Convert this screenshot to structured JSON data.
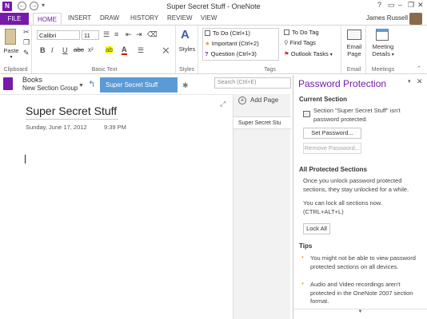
{
  "window": {
    "title": "Super Secret Stuff - OneNote",
    "help": "?",
    "minimize": "–",
    "restore": "❐",
    "close": "✕",
    "user": "James Russell"
  },
  "quick_access": {
    "back": "←",
    "forward": "→",
    "more": "▾"
  },
  "ribbon_tabs": [
    "FILE",
    "HOME",
    "INSERT",
    "DRAW",
    "HISTORY",
    "REVIEW",
    "VIEW"
  ],
  "clipboard": {
    "paste": "Paste",
    "label": "Clipboard"
  },
  "basic_text": {
    "font": "Calibri",
    "size": "11",
    "bold": "B",
    "italic": "I",
    "underline": "U",
    "strike": "abc",
    "subscript": "x²",
    "highlight": "ab",
    "fontcolor": "A",
    "label": "Basic Text"
  },
  "styles": {
    "label": "Styles",
    "button": "Styles"
  },
  "tags": {
    "items": [
      "To Do (Ctrl+1)",
      "Important (Ctrl+2)",
      "Question (Ctrl+3)"
    ],
    "todo_tag": "To Do Tag",
    "find_tags": "Find Tags",
    "outlook": "Outlook Tasks",
    "label": "Tags"
  },
  "email": {
    "line1": "Email",
    "line2": "Page",
    "label": "Email"
  },
  "meetings": {
    "line1": "Meeting",
    "line2": "Details",
    "label": "Meetings"
  },
  "notebook": {
    "name": "Books",
    "group": "New Section Group",
    "section": "Super Secret Stuff",
    "search_placeholder": "Search (Ctrl+E)"
  },
  "page": {
    "title": "Super Secret Stuff",
    "date": "Sunday, June 17, 2012",
    "time": "9:39 PM",
    "add_page": "Add Page",
    "page_entry": "Super Secret Stu"
  },
  "pane": {
    "title": "Password Protection",
    "current_section": "Current Section",
    "status": "Section \"Super Secret Stuff\" isn't password protected.",
    "set_password": "Set Password...",
    "remove_password": "Remove Password...",
    "all_protected": "All Protected Sections",
    "unlock_info": "Once you unlock password protected sections, they stay unlocked for a while.",
    "lock_info": "You can lock all sections now. (CTRL+ALT+L)",
    "lock_all": "Lock All",
    "tips": "Tips",
    "tip1": "You might not be able to view password protected sections on all devices.",
    "tip2": "Audio and Video recordings aren't protected in the OneNote 2007 section format."
  },
  "colors": {
    "accent": "#7719aa",
    "section_tab": "#5b9bd5"
  }
}
